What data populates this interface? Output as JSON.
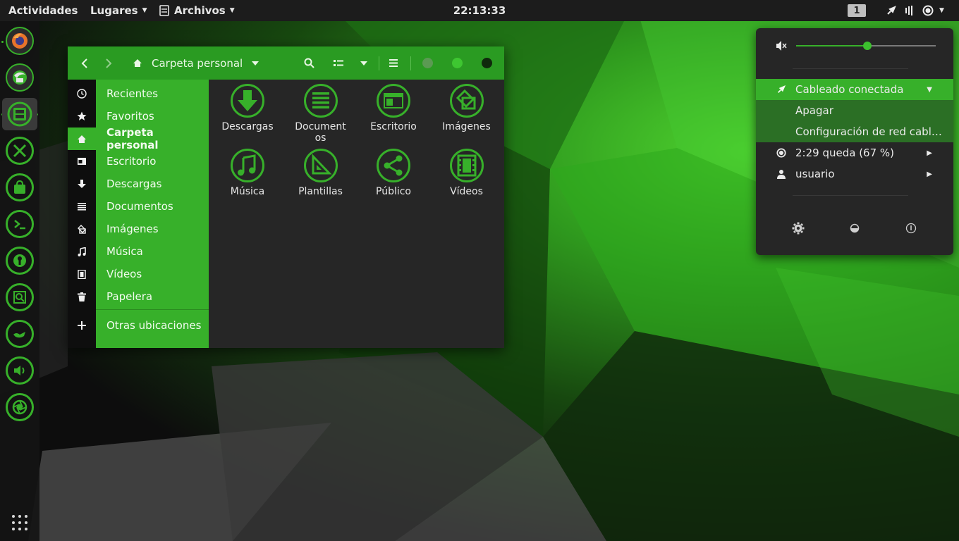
{
  "topbar": {
    "activities": "Actividades",
    "places": "Lugares",
    "files": "Archivos",
    "clock": "22:13:33",
    "workspace": "1"
  },
  "dock": {
    "apps": [
      "firefox",
      "thunderbird",
      "files",
      "tools",
      "software-center",
      "terminal",
      "keyring",
      "screenshot-viewer",
      "genie",
      "volume",
      "camera-shutter"
    ]
  },
  "files_window": {
    "path": "Carpeta personal",
    "sidebar": [
      {
        "label": "Recientes",
        "icon": "clock-icon"
      },
      {
        "label": "Favoritos",
        "icon": "star-icon"
      },
      {
        "label": "Carpeta personal",
        "icon": "home-icon"
      },
      {
        "label": "Escritorio",
        "icon": "desktop-icon"
      },
      {
        "label": "Descargas",
        "icon": "download-icon"
      },
      {
        "label": "Documentos",
        "icon": "document-icon"
      },
      {
        "label": "Imágenes",
        "icon": "image-icon"
      },
      {
        "label": "Música",
        "icon": "music-icon"
      },
      {
        "label": "Vídeos",
        "icon": "video-icon"
      },
      {
        "label": "Papelera",
        "icon": "trash-icon"
      },
      {
        "label": "Otras ubicaciones",
        "icon": "plus-icon"
      }
    ],
    "folders": [
      {
        "label": "Descargas",
        "icon": "download-folder-icon"
      },
      {
        "label": "Documentos",
        "icon": "documents-folder-icon"
      },
      {
        "label": "Escritorio",
        "icon": "desktop-folder-icon"
      },
      {
        "label": "Imágenes",
        "icon": "pictures-folder-icon"
      },
      {
        "label": "Música",
        "icon": "music-folder-icon"
      },
      {
        "label": "Plantillas",
        "icon": "templates-folder-icon"
      },
      {
        "label": "Público",
        "icon": "public-folder-icon"
      },
      {
        "label": "Vídeos",
        "icon": "videos-folder-icon"
      }
    ]
  },
  "system_menu": {
    "volume_level": 0.51,
    "network": "Cableado conectada",
    "network_off": "Apagar",
    "network_settings": "Configuración de red cabl…",
    "battery": "2:29 queda (67 %)",
    "user": "usuario"
  },
  "colors": {
    "accent": "#37b02a",
    "header": "#2a9b22",
    "panel": "#1c1c1c",
    "window_bg": "#262626"
  }
}
